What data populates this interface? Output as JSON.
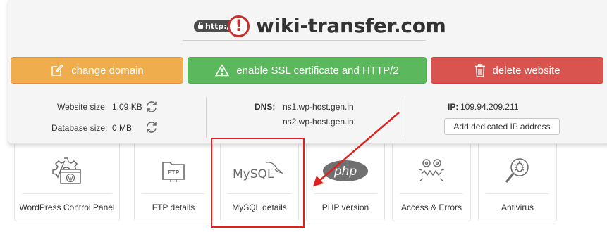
{
  "domain": {
    "http_badge": "http://",
    "warning_symbol": "!",
    "name": "wiki-transfer.com"
  },
  "actions": {
    "change_domain": "change domain",
    "enable_ssl": "enable SSL certificate and HTTP/2",
    "delete_website": "delete website"
  },
  "info": {
    "website_size_label": "Website size:",
    "website_size_value": "1.09 KB",
    "database_size_label": "Database size:",
    "database_size_value": "0 MB",
    "dns_label": "DNS:",
    "dns_1": "ns1.wp-host.gen.in",
    "dns_2": "ns2.wp-host.gen.in",
    "ip_label": "IP:",
    "ip_value": "109.94.209.211",
    "add_ip_button": "Add dedicated IP address"
  },
  "tiles": [
    {
      "label": "WordPress Control Panel",
      "icon": "wordpress-gear-icon"
    },
    {
      "label": "FTP details",
      "icon": "ftp-folder-icon"
    },
    {
      "label": "MySQL details",
      "icon": "mysql-icon"
    },
    {
      "label": "PHP version",
      "icon": "php-icon"
    },
    {
      "label": "Access & Errors",
      "icon": "access-errors-icon"
    },
    {
      "label": "Antivirus",
      "icon": "antivirus-icon"
    }
  ],
  "logos": {
    "mysql": "MySQL",
    "php": "php",
    "ftp": "FTP"
  },
  "colors": {
    "orange": "#efad4d",
    "green": "#5cb85c",
    "red": "#d9534f",
    "annotation": "#e0201c"
  }
}
